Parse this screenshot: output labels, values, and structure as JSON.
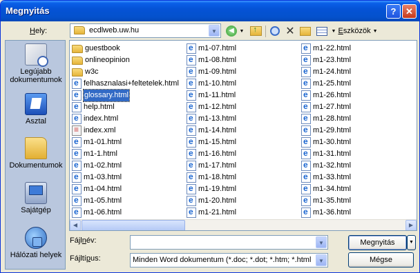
{
  "window": {
    "title": "Megnyitás"
  },
  "location": {
    "label_pre": "",
    "label_key": "H",
    "label_post": "ely:",
    "value": "ecdlweb.uw.hu"
  },
  "toolbar": {
    "tools_label": "Eszközök",
    "tools_key": "E"
  },
  "places": [
    {
      "label": "Legújabb dokumentumok",
      "icon": "recent-documents-icon"
    },
    {
      "label": "Asztal",
      "icon": "desktop-icon"
    },
    {
      "label": "Dokumentumok",
      "icon": "documents-folder-icon"
    },
    {
      "label": "Sajátgép",
      "icon": "my-computer-icon"
    },
    {
      "label": "Hálózati helyek",
      "icon": "network-places-icon"
    }
  ],
  "files": {
    "col1": [
      {
        "name": "guestbook",
        "type": "folder"
      },
      {
        "name": "onlineopinion",
        "type": "folder"
      },
      {
        "name": "w3c",
        "type": "folder"
      },
      {
        "name": "felhasznalasi+feltetelek.html",
        "type": "html"
      },
      {
        "name": "glossary.html",
        "type": "html",
        "selected": true
      },
      {
        "name": "help.html",
        "type": "html"
      },
      {
        "name": "index.html",
        "type": "html"
      },
      {
        "name": "index.xml",
        "type": "xml"
      },
      {
        "name": "m1-01.html",
        "type": "html"
      },
      {
        "name": "m1-1.html",
        "type": "html"
      },
      {
        "name": "m1-02.html",
        "type": "html"
      },
      {
        "name": "m1-03.html",
        "type": "html"
      },
      {
        "name": "m1-04.html",
        "type": "html"
      },
      {
        "name": "m1-05.html",
        "type": "html"
      },
      {
        "name": "m1-06.html",
        "type": "html"
      }
    ],
    "col2": [
      "m1-07.html",
      "m1-08.html",
      "m1-09.html",
      "m1-10.html",
      "m1-11.html",
      "m1-12.html",
      "m1-13.html",
      "m1-14.html",
      "m1-15.html",
      "m1-16.html",
      "m1-17.html",
      "m1-18.html",
      "m1-19.html",
      "m1-20.html",
      "m1-21.html"
    ],
    "col3": [
      "m1-22.html",
      "m1-23.html",
      "m1-24.html",
      "m1-25.html",
      "m1-26.html",
      "m1-27.html",
      "m1-28.html",
      "m1-29.html",
      "m1-30.html",
      "m1-31.html",
      "m1-32.html",
      "m1-33.html",
      "m1-34.html",
      "m1-35.html",
      "m1-36.html"
    ]
  },
  "filename": {
    "label_pre": "Fájl",
    "label_key": "n",
    "label_post": "év:",
    "value": ""
  },
  "filetype": {
    "label_pre": "Fájltí",
    "label_key": "p",
    "label_post": "us:",
    "value": "Minden Word dokumentum (*.doc; *.dot; *.htm; *.html"
  },
  "buttons": {
    "open": "Megnyitás",
    "cancel": "Mégse"
  },
  "colors": {
    "title_bar": "#0553D6",
    "selection": "#316AC5",
    "places_bg": "#B9C7DE"
  }
}
